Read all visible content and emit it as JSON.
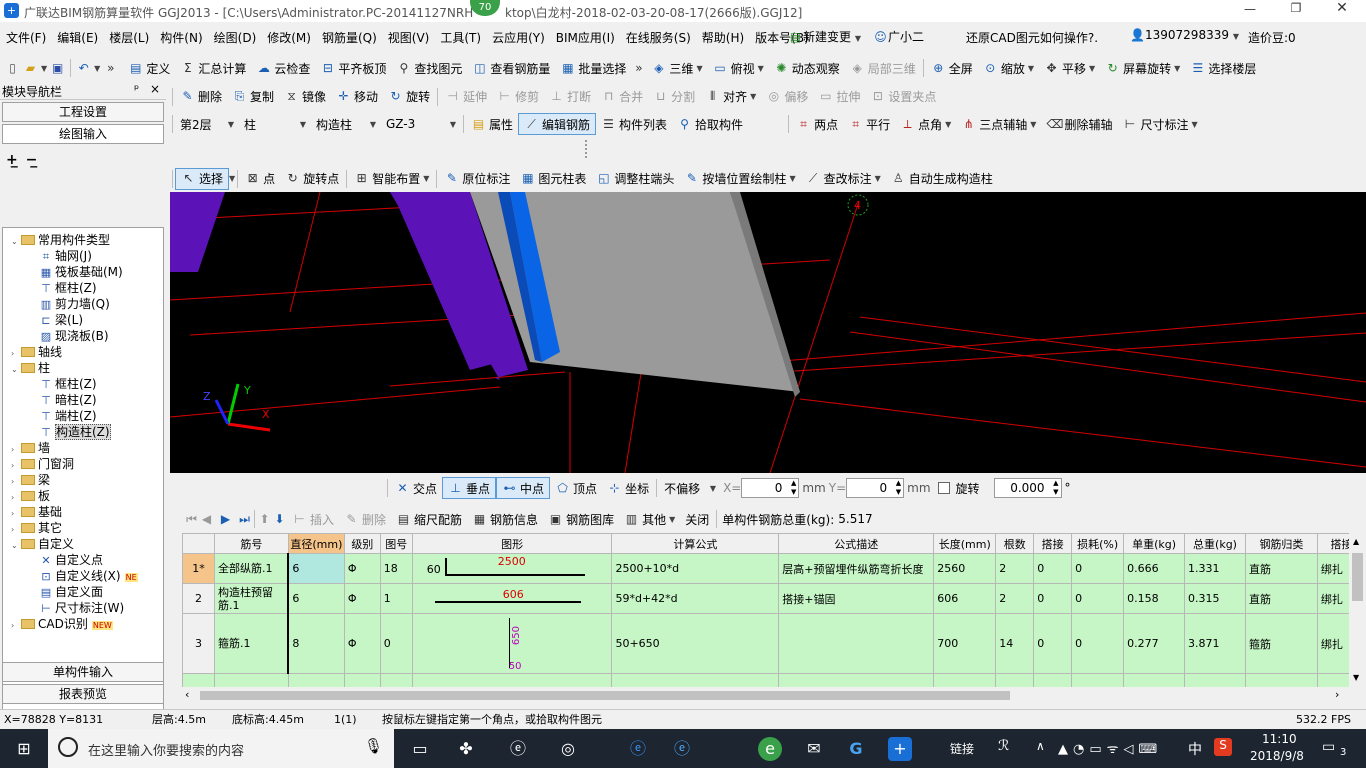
{
  "window": {
    "title": "广联达BIM钢筋算量软件 GGJ2013 - [C:\\Users\\Administrator.PC-20141127NRH\\Desktop\\白龙村-2018-02-03-20-08-17(2666版).GGJ12]",
    "badge": "70",
    "title_left": "广联达BIM钢筋算量软件 GGJ2013 - [C:\\Users\\Administrator.PC-20141127NRH",
    "title_right": "ktop\\白龙村-2018-02-03-20-08-17(2666版).GGJ12]"
  },
  "menu": {
    "items": [
      "文件(F)",
      "编辑(E)",
      "楼层(L)",
      "构件(N)",
      "绘图(D)",
      "修改(M)",
      "钢筋量(Q)",
      "视图(V)",
      "工具(T)",
      "云应用(Y)",
      "BIM应用(I)",
      "在线服务(S)",
      "帮助(H)",
      "版本号(B)"
    ],
    "new_change": "新建变更",
    "xiaoer": "广小二",
    "hint": "还原CAD图元如何操作?.",
    "phone": "13907298339",
    "cost": "造价豆:0"
  },
  "toolbar1": {
    "define": "定义",
    "sum": "汇总计算",
    "cloud_check": "云检查",
    "flat_top": "平齐板顶",
    "find": "查找图元",
    "view_rebar": "查看钢筋量",
    "batch_select": "批量选择",
    "three_d": "三维",
    "top_view": "俯视",
    "dynamic": "动态观察",
    "local_3d": "局部三维",
    "fullscreen": "全屏",
    "zoom": "缩放",
    "pan": "平移",
    "rotate_screen": "屏幕旋转",
    "select_floor": "选择楼层"
  },
  "toolbar2": {
    "delete": "删除",
    "copy": "复制",
    "mirror": "镜像",
    "move": "移动",
    "rotate": "旋转",
    "extend": "延伸",
    "trim": "修剪",
    "break": "打断",
    "merge": "合并",
    "split": "分割",
    "align": "对齐",
    "offset": "偏移",
    "stretch": "拉伸",
    "set_grip": "设置夹点"
  },
  "toolbar3": {
    "floor": "第2层",
    "type": "柱",
    "subtype": "构造柱",
    "name": "GZ-3",
    "property": "属性",
    "edit_rebar": "编辑钢筋",
    "comp_list": "构件列表",
    "pick": "拾取构件",
    "two_points": "两点",
    "parallel": "平行",
    "point_angle": "点角",
    "three_aux": "三点辅轴",
    "del_aux": "删除辅轴",
    "dimension": "尺寸标注"
  },
  "toolbar4": {
    "select": "选择",
    "point": "点",
    "rotate_point": "旋转点",
    "smart_layout": "智能布置",
    "orig_mark": "原位标注",
    "elem_table": "图元柱表",
    "adjust_end": "调整柱端头",
    "by_wall": "按墙位置绘制柱",
    "modify_mark": "查改标注",
    "auto_gen": "自动生成构造柱"
  },
  "nav": {
    "title": "模块导航栏",
    "pin": "ᵖ",
    "close": "×",
    "tab_project": "工程设置",
    "tab_draw": "绘图输入",
    "tab_single": "单构件输入",
    "tab_report": "报表预览",
    "tree": [
      {
        "label": "常用构件类型",
        "level": 0,
        "type": "folder",
        "open": true
      },
      {
        "label": "轴网(J)",
        "level": 2,
        "type": "axis"
      },
      {
        "label": "筏板基础(M)",
        "level": 2,
        "type": "raft"
      },
      {
        "label": "框柱(Z)",
        "level": 2,
        "type": "col"
      },
      {
        "label": "剪力墙(Q)",
        "level": 2,
        "type": "wall"
      },
      {
        "label": "梁(L)",
        "level": 2,
        "type": "beam"
      },
      {
        "label": "现浇板(B)",
        "level": 2,
        "type": "slab"
      },
      {
        "label": "轴线",
        "level": 0,
        "type": "folder"
      },
      {
        "label": "柱",
        "level": 0,
        "type": "folder",
        "open": true
      },
      {
        "label": "框柱(Z)",
        "level": 2,
        "type": "col"
      },
      {
        "label": "暗柱(Z)",
        "level": 2,
        "type": "col"
      },
      {
        "label": "端柱(Z)",
        "level": 2,
        "type": "col"
      },
      {
        "label": "构造柱(Z)",
        "level": 2,
        "type": "col",
        "selected": true
      },
      {
        "label": "墙",
        "level": 0,
        "type": "folder"
      },
      {
        "label": "门窗洞",
        "level": 0,
        "type": "folder"
      },
      {
        "label": "梁",
        "level": 0,
        "type": "folder"
      },
      {
        "label": "板",
        "level": 0,
        "type": "folder"
      },
      {
        "label": "基础",
        "level": 0,
        "type": "folder"
      },
      {
        "label": "其它",
        "level": 0,
        "type": "folder"
      },
      {
        "label": "自定义",
        "level": 0,
        "type": "folder",
        "open": true
      },
      {
        "label": "自定义点",
        "level": 2,
        "type": "pt"
      },
      {
        "label": "自定义线(X)",
        "level": 2,
        "type": "line",
        "tag": "NE"
      },
      {
        "label": "自定义面",
        "level": 2,
        "type": "face"
      },
      {
        "label": "尺寸标注(W)",
        "level": 2,
        "type": "dim"
      },
      {
        "label": "CAD识别",
        "level": 0,
        "type": "folder",
        "tag": "NEW"
      }
    ]
  },
  "viewport": {
    "axis_number": "4",
    "axis_x": "X",
    "axis_y": "Y",
    "axis_z": "Z",
    "colors": {
      "purple": "#5b13b8",
      "blue": "#0a64e6",
      "grey": "#9a9a9a",
      "grid": "#d40000"
    }
  },
  "snap": {
    "intersect": "交点",
    "perp": "垂点",
    "mid": "中点",
    "vertex": "顶点",
    "coord": "坐标",
    "offset_mode": "不偏移",
    "x_label": "X=",
    "x_value": "0",
    "mm1": "mm",
    "y_label": "Y=",
    "y_value": "0",
    "mm2": "mm",
    "rotate": "旋转",
    "angle": "0.000",
    "deg": "°"
  },
  "rebar_tb": {
    "insert": "插入",
    "delete": "删除",
    "scale": "缩尺配筋",
    "info": "钢筋信息",
    "lib": "钢筋图库",
    "other": "其他",
    "close": "关闭",
    "total_label": "单构件钢筋总重(kg):",
    "total_value": "5.517"
  },
  "table": {
    "headers": [
      "筋号",
      "直径(mm)",
      "级别",
      "图号",
      "图形",
      "计算公式",
      "公式描述",
      "长度(mm)",
      "根数",
      "搭接",
      "损耗(%)",
      "单重(kg)",
      "总重(kg)",
      "钢筋归类",
      "搭接"
    ],
    "rows": [
      {
        "idx": "1*",
        "name": "全部纵筋.1",
        "dia": "6",
        "grade": "Φ",
        "fig": "18",
        "shape_l": "60",
        "shape_v": "2500",
        "formula": "2500+10*d",
        "desc": "层高+预留埋件纵筋弯折长度",
        "len": "2560",
        "count": "2",
        "lap": "0",
        "loss": "0",
        "unit": "0.666",
        "total": "1.331",
        "cat": "直筋",
        "lapt": "绑扎"
      },
      {
        "idx": "2",
        "name": "构造柱预留筋.1",
        "dia": "6",
        "grade": "Φ",
        "fig": "1",
        "shape_l": "",
        "shape_v": "606",
        "formula": "59*d+42*d",
        "desc": "搭接+锚固",
        "len": "606",
        "count": "2",
        "lap": "0",
        "loss": "0",
        "unit": "0.158",
        "total": "0.315",
        "cat": "直筋",
        "lapt": "绑扎"
      },
      {
        "idx": "3",
        "name": "箍筋.1",
        "dia": "8",
        "grade": "Φ",
        "fig": "0",
        "shape_l": "650",
        "shape_v": "50",
        "formula": "50+650",
        "desc": "",
        "len": "700",
        "count": "14",
        "lap": "0",
        "loss": "0",
        "unit": "0.277",
        "total": "3.871",
        "cat": "箍筋",
        "lapt": "绑扎"
      }
    ]
  },
  "status": {
    "coords": "X=78828 Y=8131",
    "floor_h": "层高:4.5m",
    "base_h": "底标高:4.45m",
    "count": "1(1)",
    "hint": "按鼠标左键指定第一个角点，或拾取构件图元",
    "fps": "532.2 FPS"
  },
  "taskbar": {
    "search": "在这里输入你要搜索的内容",
    "link": "链接",
    "ime": "中",
    "time": "11:10",
    "date": "2018/9/8",
    "notif": "3"
  }
}
